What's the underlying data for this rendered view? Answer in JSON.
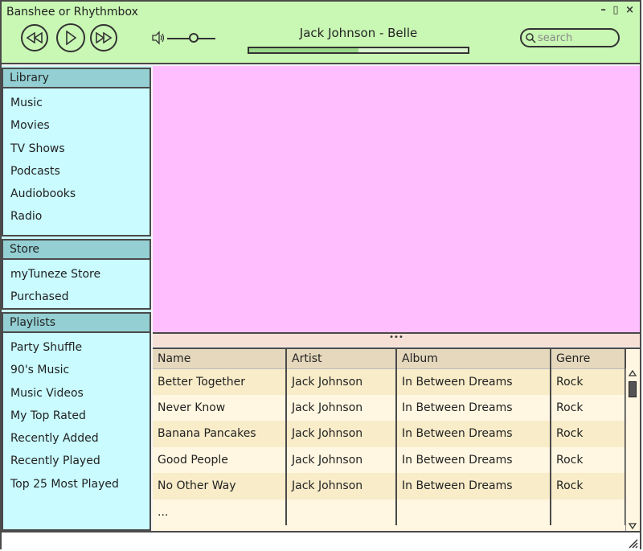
{
  "window": {
    "title": "Banshee or Rhythmbox",
    "controls": {
      "minimize": "–",
      "maximize": "▯",
      "close": "×"
    }
  },
  "player": {
    "now_playing": "Jack Johnson - Belle",
    "progress_fraction": 0.5,
    "volume_fraction": 0.45,
    "search_placeholder": "search"
  },
  "sidebar": {
    "library": {
      "header": "Library",
      "items": [
        "Music",
        "Movies",
        "TV Shows",
        "Podcasts",
        "Audiobooks",
        "Radio"
      ]
    },
    "store": {
      "header": "Store",
      "items": [
        "myTuneze Store",
        "Purchased"
      ]
    },
    "playlists": {
      "header": "Playlists",
      "items": [
        "Party Shuffle",
        "90's Music",
        "Music Videos",
        "My Top Rated",
        "Recently Added",
        "Recently Played",
        "Top 25 Most Played"
      ]
    }
  },
  "splitter": {
    "handle": "•••"
  },
  "tracklist": {
    "columns": [
      "Name",
      "Artist",
      "Album",
      "Genre"
    ],
    "rows": [
      [
        "Better Together",
        "Jack Johnson",
        "In Between Dreams",
        "Rock"
      ],
      [
        "Never Know",
        "Jack Johnson",
        "In Between Dreams",
        "Rock"
      ],
      [
        "Banana Pancakes",
        "Jack Johnson",
        "In Between Dreams",
        "Rock"
      ],
      [
        "Good People",
        "Jack Johnson",
        "In Between Dreams",
        "Rock"
      ],
      [
        "No Other Way",
        "Jack Johnson",
        "In Between Dreams",
        "Rock"
      ],
      [
        "...",
        "",
        "",
        ""
      ]
    ]
  },
  "colors": {
    "topbar": "#c9f7b4",
    "sidebar": "#c9fbff",
    "sidebar_header": "#93cfd3",
    "visual_area": "#ffbfff",
    "tracklist": "#fff7e1",
    "tracklist_header": "#e5d8bd"
  }
}
